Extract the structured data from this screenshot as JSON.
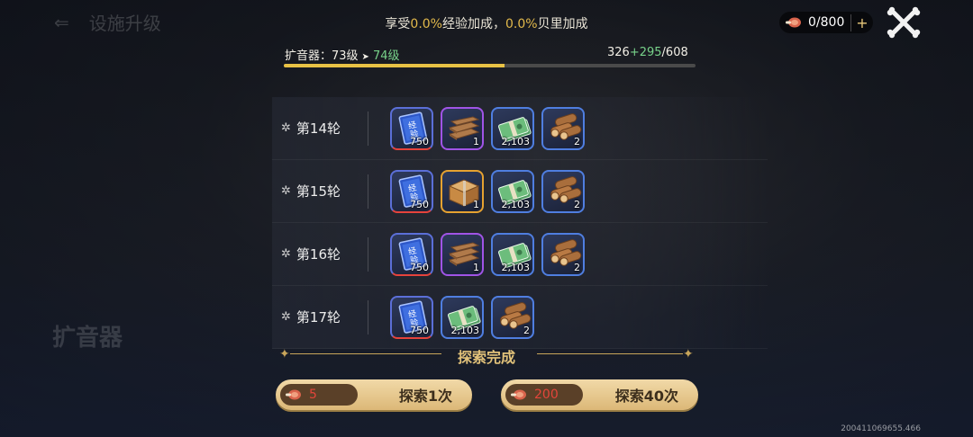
{
  "background": {
    "title": "设施升级",
    "left_text": "扩音器"
  },
  "bonus": {
    "prefix": "享受",
    "exp_value": "0.0%",
    "exp_label": "经验加成，",
    "beli_value": "0.0%",
    "beli_label": "贝里加成"
  },
  "currency": {
    "icon": "meat-icon",
    "amount": "0/800",
    "plus": "+"
  },
  "level": {
    "label": "扩音器：73级",
    "arrow": "➤",
    "next": "74级"
  },
  "exp": {
    "current": "326",
    "gain": "+295",
    "total": "/608",
    "fill_fraction": 0.536
  },
  "rounds": [
    {
      "label": "第14轮",
      "items": [
        {
          "name": "exp-book-icon",
          "qty": "750",
          "rarity": "red"
        },
        {
          "name": "wood-plank-icon",
          "qty": "1",
          "rarity": "purple"
        },
        {
          "name": "cash-bundle-icon",
          "qty": "2,103",
          "rarity": "blue"
        },
        {
          "name": "log-pile-icon",
          "qty": "2",
          "rarity": "blue"
        }
      ]
    },
    {
      "label": "第15轮",
      "items": [
        {
          "name": "exp-book-icon",
          "qty": "750",
          "rarity": "red"
        },
        {
          "name": "wood-crate-icon",
          "qty": "1",
          "rarity": "gold"
        },
        {
          "name": "cash-bundle-icon",
          "qty": "2,103",
          "rarity": "blue"
        },
        {
          "name": "log-pile-icon",
          "qty": "2",
          "rarity": "blue"
        }
      ]
    },
    {
      "label": "第16轮",
      "items": [
        {
          "name": "exp-book-icon",
          "qty": "750",
          "rarity": "red"
        },
        {
          "name": "wood-plank-icon",
          "qty": "1",
          "rarity": "purple"
        },
        {
          "name": "cash-bundle-icon",
          "qty": "2,103",
          "rarity": "blue"
        },
        {
          "name": "log-pile-icon",
          "qty": "2",
          "rarity": "blue"
        }
      ]
    },
    {
      "label": "第17轮",
      "items": [
        {
          "name": "exp-book-icon",
          "qty": "750",
          "rarity": "red"
        },
        {
          "name": "cash-bundle-icon",
          "qty": "2,103",
          "rarity": "blue"
        },
        {
          "name": "log-pile-icon",
          "qty": "2",
          "rarity": "blue"
        }
      ]
    }
  ],
  "complete_label": "探索完成",
  "buttons": {
    "explore1": {
      "cost": "5",
      "label": "探索1次"
    },
    "explore40": {
      "cost": "200",
      "label": "探索40次"
    }
  },
  "footer_id": "200411069655.466",
  "colors": {
    "accent_gold": "#e2c27a",
    "exp_green": "#78d28a",
    "cost_red": "#e3453a"
  }
}
